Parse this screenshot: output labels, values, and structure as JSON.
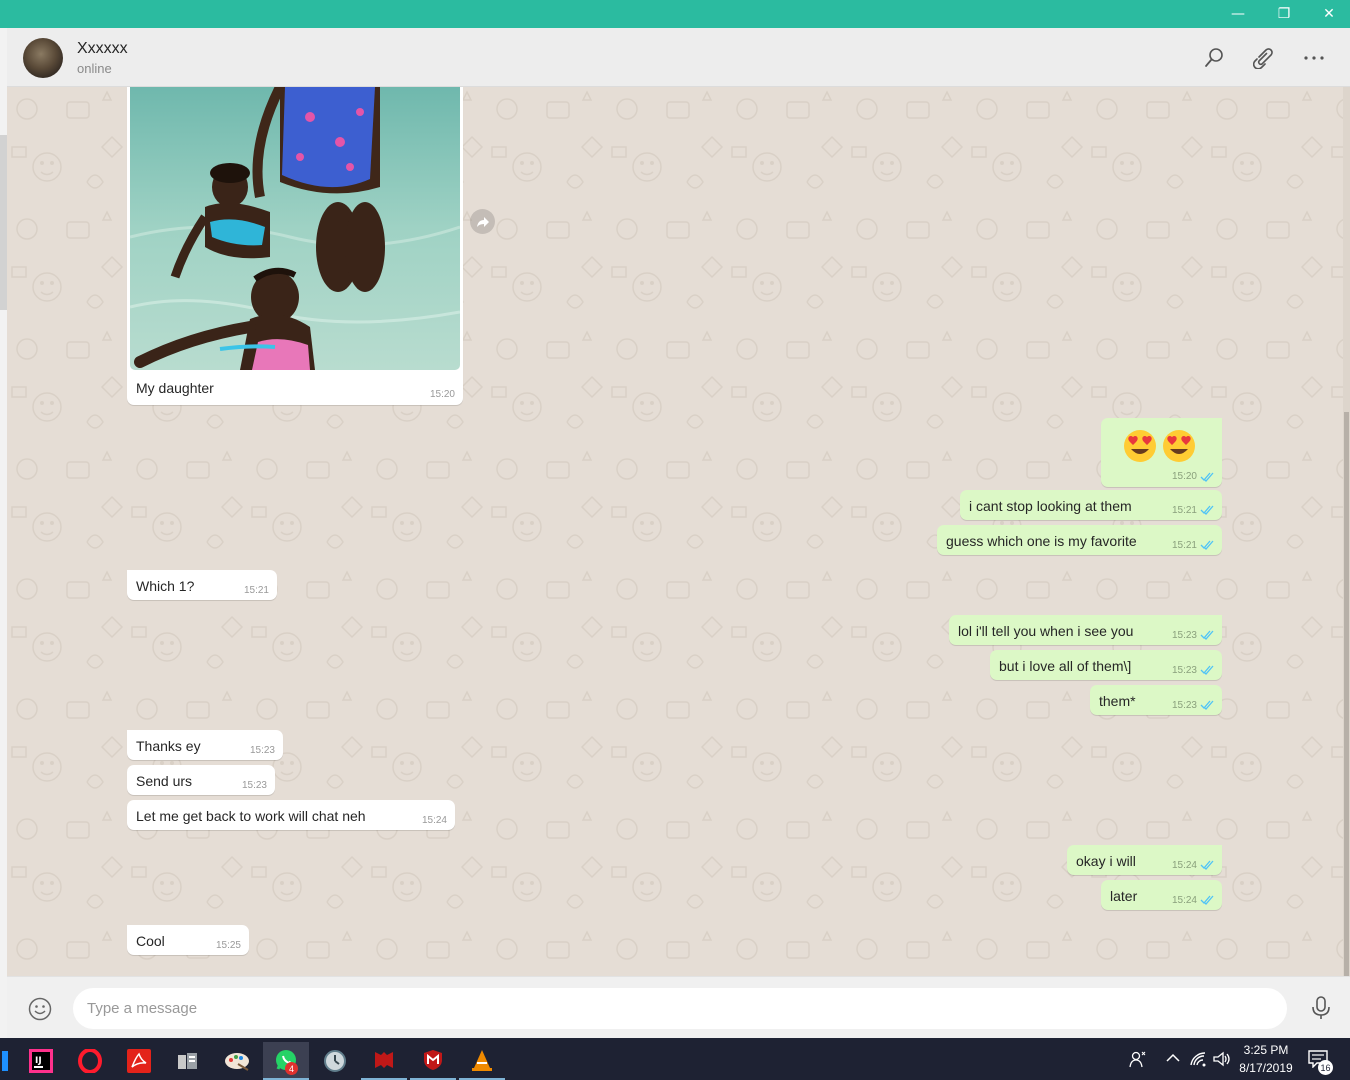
{
  "window": {
    "minimize_glyph": "—",
    "maximize_glyph": "❐",
    "close_glyph": "✕"
  },
  "header": {
    "contact_name": "Xxxxxx",
    "status": "online",
    "icons": [
      "search-icon",
      "attach-icon",
      "more-icon"
    ]
  },
  "image_message": {
    "caption": "My daughter",
    "time": "15:20"
  },
  "emoji_message": {
    "emoji": [
      "heart-eyes-emoji",
      "heart-eyes-emoji"
    ],
    "time": "15:20"
  },
  "messages": [
    {
      "dir": "out",
      "text": "i cant stop looking at them",
      "time": "15:21"
    },
    {
      "dir": "out",
      "text": "guess which one is my favorite",
      "time": "15:21"
    },
    {
      "dir": "in",
      "text": "Which 1?",
      "time": "15:21"
    },
    {
      "dir": "out",
      "text": "lol i'll tell you when i see you",
      "time": "15:23"
    },
    {
      "dir": "out",
      "text": "but i love all of them\\]",
      "time": "15:23"
    },
    {
      "dir": "out",
      "text": "them*",
      "time": "15:23"
    },
    {
      "dir": "in",
      "text": "Thanks ey",
      "time": "15:23"
    },
    {
      "dir": "in",
      "text": "Send urs",
      "time": "15:23"
    },
    {
      "dir": "in",
      "text": "Let me get back to work will chat neh",
      "time": "15:24"
    },
    {
      "dir": "out",
      "text": "okay i will",
      "time": "15:24"
    },
    {
      "dir": "out",
      "text": "later",
      "time": "15:24"
    },
    {
      "dir": "in",
      "text": "Cool",
      "time": "15:25"
    }
  ],
  "composer": {
    "placeholder": "Type a message"
  },
  "taskbar": {
    "apps": [
      "start-icon",
      "intellij-icon",
      "opera-icon",
      "acrobat-icon",
      "file-manager-icon",
      "paint-icon",
      "whatsapp-icon",
      "clock-app-icon",
      "mcafee-icon",
      "mcafee-shield-icon",
      "vlc-icon"
    ],
    "whatsapp_badge": "4",
    "notification_badge": "16",
    "time": "3:25 PM",
    "date": "8/17/2019"
  },
  "colors": {
    "titlebar": "#2bbba0",
    "chat_bg": "#e5ddd5",
    "incoming": "#ffffff",
    "outgoing": "#dcf8c6",
    "read_tick": "#4fc3f7",
    "taskbar": "#1e2233"
  }
}
